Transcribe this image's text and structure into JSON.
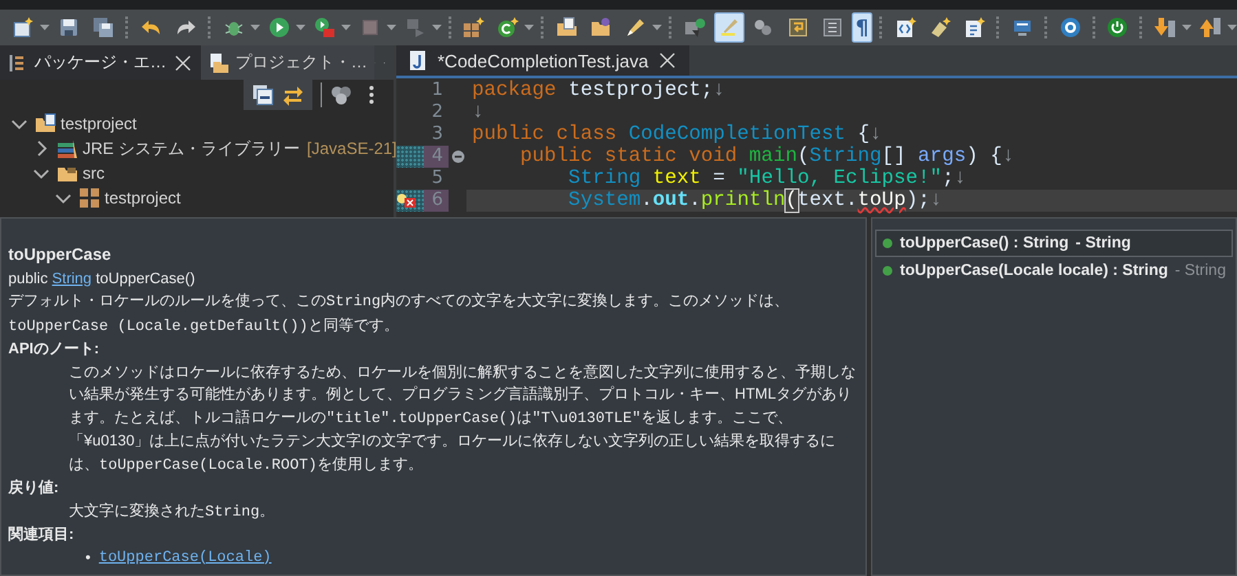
{
  "toolbar": {
    "items": [
      {
        "kind": "new",
        "dropdown": true,
        "pressed": false,
        "disabled": false
      },
      {
        "kind": "save",
        "dropdown": false,
        "pressed": false,
        "disabled": false
      },
      {
        "kind": "saveall",
        "dropdown": false,
        "pressed": false,
        "disabled": false
      },
      {
        "kind": "separator"
      },
      {
        "kind": "undo",
        "dropdown": false,
        "pressed": false,
        "disabled": false
      },
      {
        "kind": "redo",
        "dropdown": false,
        "pressed": false,
        "disabled": false
      },
      {
        "kind": "separator"
      },
      {
        "kind": "bug",
        "dropdown": true,
        "pressed": false,
        "disabled": false
      },
      {
        "kind": "run",
        "dropdown": true,
        "pressed": false,
        "disabled": false
      },
      {
        "kind": "runtool",
        "dropdown": true,
        "pressed": false,
        "disabled": false
      },
      {
        "kind": "stop",
        "dropdown": true,
        "pressed": false,
        "disabled": true
      },
      {
        "kind": "disconnect",
        "dropdown": true,
        "pressed": false,
        "disabled": true
      },
      {
        "kind": "separator"
      },
      {
        "kind": "pkgplus",
        "dropdown": false,
        "pressed": false,
        "disabled": false
      },
      {
        "kind": "classplus",
        "dropdown": true,
        "pressed": false,
        "disabled": false
      },
      {
        "kind": "separator"
      },
      {
        "kind": "opentype",
        "dropdown": false,
        "pressed": false,
        "disabled": false
      },
      {
        "kind": "folder",
        "dropdown": false,
        "pressed": false,
        "disabled": false
      },
      {
        "kind": "brush",
        "dropdown": true,
        "pressed": false,
        "disabled": false
      },
      {
        "kind": "separator"
      },
      {
        "kind": "task",
        "dropdown": false,
        "pressed": false,
        "disabled": false
      },
      {
        "kind": "highlight",
        "dropdown": false,
        "pressed": true,
        "disabled": false
      },
      {
        "kind": "link",
        "dropdown": false,
        "pressed": false,
        "disabled": false
      },
      {
        "kind": "wrap",
        "dropdown": false,
        "pressed": false,
        "disabled": false
      },
      {
        "kind": "block",
        "dropdown": false,
        "pressed": false,
        "disabled": false
      },
      {
        "kind": "pilcrow",
        "glyph": "¶",
        "dropdown": false,
        "pressed": true,
        "disabled": false
      },
      {
        "kind": "separator"
      },
      {
        "kind": "xml",
        "dropdown": false,
        "pressed": false,
        "disabled": false
      },
      {
        "kind": "snippet",
        "dropdown": false,
        "pressed": false,
        "disabled": false
      },
      {
        "kind": "newfile",
        "dropdown": false,
        "pressed": false,
        "disabled": false
      },
      {
        "kind": "separator"
      },
      {
        "kind": "monitor",
        "dropdown": false,
        "pressed": false,
        "disabled": false
      },
      {
        "kind": "separator"
      },
      {
        "kind": "gear",
        "dropdown": false,
        "pressed": false,
        "disabled": false
      },
      {
        "kind": "separator"
      },
      {
        "kind": "power",
        "dropdown": false,
        "pressed": false,
        "disabled": false
      },
      {
        "kind": "separator"
      },
      {
        "kind": "down",
        "dropdown": true,
        "pressed": false,
        "disabled": false
      },
      {
        "kind": "up",
        "dropdown": true,
        "pressed": false,
        "disabled": false
      }
    ]
  },
  "explorer": {
    "tabs": [
      {
        "label": "パッケージ・エ…",
        "selected": true,
        "closable": true
      },
      {
        "label": "プロジェクト・…",
        "selected": false,
        "closable": false
      }
    ],
    "tree": [
      {
        "label": "testproject",
        "kind": "project",
        "expanded": true,
        "children": [
          {
            "label": "JRE システム・ライブラリー",
            "decoration": "[JavaSE-21]",
            "kind": "library",
            "expanded": false
          },
          {
            "label": "src",
            "kind": "srcfolder",
            "expanded": true,
            "children": [
              {
                "label": "testproject",
                "kind": "package",
                "expanded": true
              }
            ]
          }
        ]
      }
    ]
  },
  "editor": {
    "tab": {
      "title": "*CodeCompletionTest.java",
      "selected": true
    },
    "lines": [
      {
        "number": "1",
        "marked": false,
        "current": false,
        "foldable": false,
        "has_error": false,
        "tokens": [
          {
            "text": "package",
            "kind": "kw"
          },
          {
            "text": " testproject;",
            "kind": "plain"
          },
          {
            "text": "↓",
            "kind": "ws"
          }
        ]
      },
      {
        "number": "2",
        "marked": false,
        "current": false,
        "foldable": false,
        "has_error": false,
        "tokens": [
          {
            "text": "↓",
            "kind": "ws"
          }
        ]
      },
      {
        "number": "3",
        "marked": false,
        "current": false,
        "foldable": false,
        "has_error": false,
        "tokens": [
          {
            "text": "public class",
            "kind": "kw"
          },
          {
            "text": " CodeCompletionTest",
            "kind": "type"
          },
          {
            "text": " {",
            "kind": "plain"
          },
          {
            "text": "↓",
            "kind": "ws"
          }
        ]
      },
      {
        "number": "4",
        "marked": true,
        "current": false,
        "foldable": true,
        "has_error": false,
        "tokens": [
          {
            "text": "    public static void",
            "kind": "kw"
          },
          {
            "text": " main",
            "kind": "method"
          },
          {
            "text": "(",
            "kind": "plain"
          },
          {
            "text": "String",
            "kind": "type"
          },
          {
            "text": "[]",
            "kind": "plain"
          },
          {
            "text": " args",
            "kind": "param"
          },
          {
            "text": ") {",
            "kind": "plain"
          },
          {
            "text": "↓",
            "kind": "ws"
          }
        ]
      },
      {
        "number": "5",
        "marked": false,
        "current": false,
        "foldable": false,
        "has_error": false,
        "tokens": [
          {
            "text": "        String",
            "kind": "type"
          },
          {
            "text": " text",
            "kind": "local"
          },
          {
            "text": " =",
            "kind": "plain"
          },
          {
            "text": " \"Hello, Eclipse!\"",
            "kind": "string"
          },
          {
            "text": ";",
            "kind": "plain"
          },
          {
            "text": "↓",
            "kind": "ws"
          }
        ]
      },
      {
        "number": "6",
        "marked": true,
        "current": true,
        "foldable": false,
        "has_error": true,
        "tokens": [
          {
            "text": "        System",
            "kind": "type"
          },
          {
            "text": ".",
            "kind": "plain"
          },
          {
            "text": "out",
            "kind": "field"
          },
          {
            "text": ".",
            "kind": "plain"
          },
          {
            "text": "println",
            "kind": "call"
          },
          {
            "text": "(",
            "kind": "bracket"
          },
          {
            "text": "text.",
            "kind": "plain"
          },
          {
            "text": "toUp",
            "kind": "error"
          },
          {
            "text": ");",
            "kind": "plain"
          },
          {
            "text": "↓",
            "kind": "ws"
          }
        ]
      }
    ]
  },
  "javadoc": {
    "title": "toUpperCase",
    "signature": [
      {
        "text": "public ",
        "kind": "text"
      },
      {
        "text": "String",
        "kind": "link"
      },
      {
        "text": " toUpperCase()",
        "kind": "text"
      }
    ],
    "description": [
      {
        "text": "デフォルト・ロケールのルールを使って、この",
        "kind": "text"
      },
      {
        "text": "String",
        "kind": "code"
      },
      {
        "text": "内のすべての文字を大文字に変換します。このメソッドは、",
        "kind": "text"
      },
      {
        "text": "toUpperCase (Locale.getDefault())",
        "kind": "code"
      },
      {
        "text": "と同等です。",
        "kind": "text"
      }
    ],
    "sections": [
      {
        "heading": "APIのノート:",
        "kind": "para",
        "body": [
          {
            "text": "このメソッドはロケールに依存するため、ロケールを個別に解釈することを意図した文字列に使用すると、予期しない結果が発生する可能性があります。例として、プログラミング言語識別子、プロトコル・キー、HTMLタグがあります。たとえば、トルコ語ロケールの",
            "kind": "text"
          },
          {
            "text": "\"title\".toUpperCase()",
            "kind": "code"
          },
          {
            "text": "は",
            "kind": "text"
          },
          {
            "text": "\"T\\u0130TLE\"",
            "kind": "code"
          },
          {
            "text": "を返します。ここで、「¥u0130」は上に点が付いたラテン大文字Iの文字です。ロケールに依存しない文字列の正しい結果を取得するには、",
            "kind": "text"
          },
          {
            "text": "toUpperCase(Locale.ROOT)",
            "kind": "code"
          },
          {
            "text": "を使用します。",
            "kind": "text"
          }
        ]
      },
      {
        "heading": "戻り値:",
        "kind": "para",
        "body": [
          {
            "text": "大文字に変換された",
            "kind": "text"
          },
          {
            "text": "String",
            "kind": "code"
          },
          {
            "text": "。",
            "kind": "text"
          }
        ]
      },
      {
        "heading": "関連項目:",
        "kind": "links",
        "links": [
          {
            "bullet": "•",
            "text": "toUpperCase(Locale)"
          }
        ]
      }
    ]
  },
  "completions": [
    {
      "label": "toUpperCase() : String",
      "qualifier": "- String",
      "selected": true
    },
    {
      "label": "toUpperCase(Locale locale) : String",
      "qualifier": "- String",
      "selected": false
    }
  ]
}
